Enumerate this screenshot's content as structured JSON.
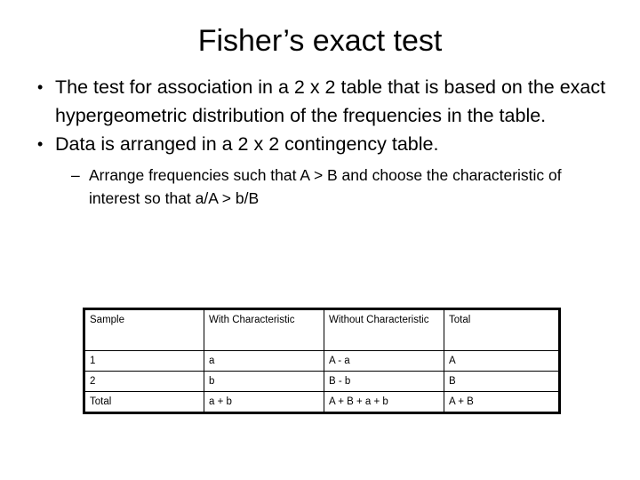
{
  "slide": {
    "title": "Fisher’s exact test",
    "background_color": "#ffffff",
    "text_color": "#000000",
    "bullets": [
      {
        "level": 1,
        "marker": "•",
        "text": "The test for association in a 2 x 2 table that is based on the exact hypergeometric distribution of the frequencies in the table."
      },
      {
        "level": 1,
        "marker": "•",
        "text": "Data is arranged in a 2 x 2 contingency table."
      },
      {
        "level": 2,
        "marker": "–",
        "text": "Arrange frequencies such that A > B and choose the characteristic of interest so that a/A > b/B"
      }
    ],
    "table": {
      "headers": [
        "Sample",
        "With Characteristic",
        "Without Characteristic",
        "Total"
      ],
      "rows": [
        [
          "1",
          "a",
          "A - a",
          "A"
        ],
        [
          "2",
          "b",
          "B - b",
          "B"
        ],
        [
          "Total",
          "a + b",
          "A + B + a + b",
          "A + B"
        ]
      ],
      "border_color": "#000000"
    }
  }
}
